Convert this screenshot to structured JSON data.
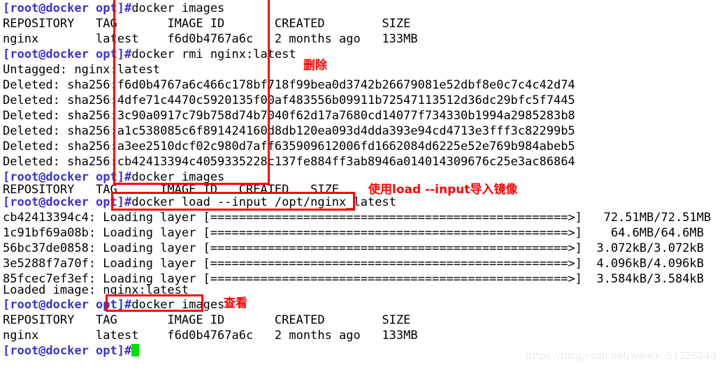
{
  "terminal": {
    "prompt": "[root@docker opt]#",
    "lines": [
      {
        "type": "command",
        "prompt": "[root@docker opt]#",
        "command": "docker images"
      },
      {
        "type": "output",
        "text": "REPOSITORY   TAG       IMAGE ID       CREATED        SIZE"
      },
      {
        "type": "output",
        "text": "nginx        latest    f6d0b4767a6c   2 months ago   133MB"
      },
      {
        "type": "command",
        "prompt": "[root@docker opt]#",
        "command": "docker rmi nginx:latest"
      },
      {
        "type": "output",
        "text": "Untagged: nginx:latest"
      },
      {
        "type": "output",
        "text": "Deleted: sha256:f6d0b4767a6c466c178bf718f99bea0d3742b26679081e52dbf8e0c7c4c42d74"
      },
      {
        "type": "output",
        "text": "Deleted: sha256:4dfe71c4470c5920135f00af483556b09911b72547113512d36dc29bfc5f7445"
      },
      {
        "type": "output",
        "text": "Deleted: sha256:3c90a0917c79b758d74b7040f62d17a7680cd14077f734330b1994a2985283b8"
      },
      {
        "type": "output",
        "text": "Deleted: sha256:a1c538085c6f891424160d8db120ea093d4dda393e94cd4713e3fff3c82299b5"
      },
      {
        "type": "output",
        "text": "Deleted: sha256:a3ee2510dcf02c980d7aff635909612006fd1662084d6225e52e769b984abeb5"
      },
      {
        "type": "output",
        "text": "Deleted: sha256:cb42413394c4059335228c137fe884ff3ab8946a014014309676c25e3ac86864"
      },
      {
        "type": "command",
        "prompt": "[root@docker opt]#",
        "command": "docker images"
      },
      {
        "type": "output",
        "text": "REPOSITORY   TAG      IMAGE ID   CREATED   SIZE"
      },
      {
        "type": "command",
        "prompt": "[root@docker opt]#",
        "command": "docker load --input /opt/nginx_latest"
      },
      {
        "type": "output",
        "text": "cb42413394c4: Loading layer [==================================================>]   72.51MB/72.51MB"
      },
      {
        "type": "output",
        "text": "1c91bf69a08b: Loading layer [==================================================>]    64.6MB/64.6MB"
      },
      {
        "type": "output",
        "text": "56bc37de0858: Loading layer [==================================================>]  3.072kB/3.072kB"
      },
      {
        "type": "output",
        "text": "3e5288f7a70f: Loading layer [==================================================>]  4.096kB/4.096kB"
      },
      {
        "type": "output",
        "text": "85fcec7ef3ef: Loading layer [==================================================>]  3.584kB/3.584kB"
      },
      {
        "type": "output",
        "text": "Loaded image: nginx:latest"
      },
      {
        "type": "command",
        "prompt": "[root@docker opt]#",
        "command": "docker images"
      },
      {
        "type": "output",
        "text": "REPOSITORY   TAG       IMAGE ID       CREATED        SIZE"
      },
      {
        "type": "output",
        "text": "nginx        latest    f6d0b4767a6c   2 months ago   133MB"
      },
      {
        "type": "command",
        "prompt": "[root@docker opt]#",
        "command": "",
        "cursor": true
      }
    ]
  },
  "annotations": {
    "delete_label": "删除",
    "load_label": "使用load --input导入镜像",
    "view_label": "查看"
  },
  "watermark": {
    "text": "https://blog.csdn.net/weixin_51326240"
  },
  "colors": {
    "prompt": "#3b33cc",
    "annotation": "#ff0000",
    "cursor": "#00e000",
    "text": "#000000",
    "background": "#ffffff"
  }
}
